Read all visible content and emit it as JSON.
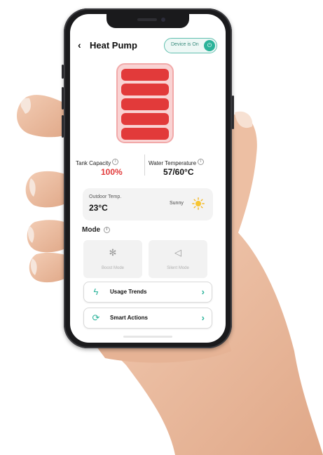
{
  "header": {
    "back_icon": "chevron-left-icon",
    "title": "Heat Pump",
    "device_toggle": {
      "label": "Device is On",
      "state": "on",
      "icon": "power-icon"
    }
  },
  "tank": {
    "level_percent": 100,
    "bars": 5,
    "fill_color": "#e23a3a"
  },
  "metrics": {
    "tank_capacity": {
      "label": "Tank Capacity",
      "value": "100%",
      "info_icon": "info-icon"
    },
    "water_temperature": {
      "label": "Water Temperature",
      "value": "57/60°C",
      "info_icon": "info-icon"
    }
  },
  "weather": {
    "label": "Outdoor Temp.",
    "temperature": "23°C",
    "condition": "Sunny",
    "icon": "sun-icon"
  },
  "mode": {
    "label": "Mode",
    "info_icon": "info-icon",
    "options": [
      {
        "label": "Boost Mode",
        "icon": "fan-icon"
      },
      {
        "label": "Silent Mode",
        "icon": "speaker-icon"
      }
    ]
  },
  "actions": [
    {
      "label": "Usage Trends",
      "icon": "lightning-icon"
    },
    {
      "label": "Smart Actions",
      "icon": "sync-icon"
    }
  ],
  "colors": {
    "accent": "#2bb39a",
    "alert": "#e23a3a"
  }
}
